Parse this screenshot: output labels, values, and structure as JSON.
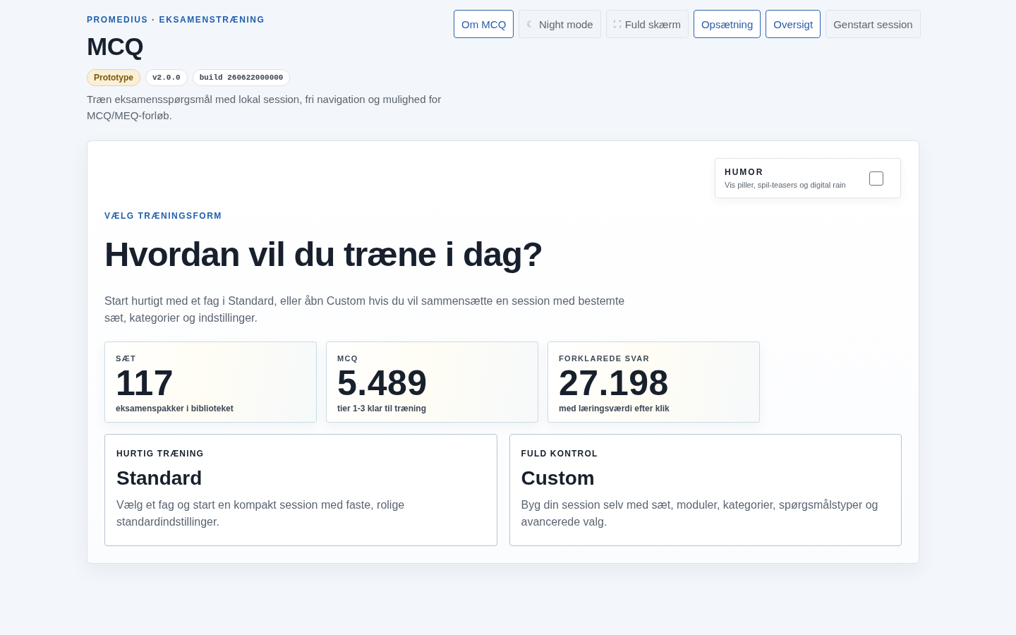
{
  "header": {
    "eyebrow": "PROMEDIUS · EKSAMENSTRÆNING",
    "title": "MCQ",
    "badges": [
      {
        "label": "Prototype",
        "kind": "status"
      },
      {
        "label": "v2.0.0",
        "kind": "code"
      },
      {
        "label": "build 260622000000",
        "kind": "code"
      }
    ],
    "description": "Træn eksamensspørgsmål med lokal session, fri navigation og mulighed for MCQ/MEQ-forløb."
  },
  "toolbar": [
    {
      "label": "Om MCQ",
      "highlighted": true,
      "kind": "plain"
    },
    {
      "label": "Night mode",
      "highlighted": false,
      "kind": "glyph",
      "glyph": "☾"
    },
    {
      "label": "Fuld skærm",
      "highlighted": false,
      "kind": "fullscreen"
    },
    {
      "label": "Opsætning",
      "highlighted": true,
      "kind": "plain"
    },
    {
      "label": "Oversigt",
      "highlighted": true,
      "kind": "plain"
    },
    {
      "label": "Genstart session",
      "highlighted": false,
      "kind": "plain"
    }
  ],
  "humor": {
    "title": "HUMOR",
    "description": "Vis piller, spil-teasers og digital rain",
    "checked": false
  },
  "intro": {
    "eyebrow": "VÆLG TRÆNINGSFORM",
    "heading": "Hvordan vil du træne i dag?",
    "lead": "Start hurtigt med et fag i Standard, eller åbn Custom hvis du vil sammensætte en session med bestemte sæt, kategorier og indstillinger."
  },
  "stats": [
    {
      "label": "SÆT",
      "value": "117",
      "caption": "eksamenspakker i biblioteket"
    },
    {
      "label": "MCQ",
      "value": "5.489",
      "caption": "tier 1-3 klar til træning"
    },
    {
      "label": "FORKLAREDE SVAR",
      "value": "27.198",
      "caption": "med læringsværdi efter klik"
    }
  ],
  "modes": [
    {
      "eyebrow": "HURTIG TRÆNING",
      "title": "Standard",
      "description": "Vælg et fag og start en kompakt session med faste, rolige standardindstillinger."
    },
    {
      "eyebrow": "FULD KONTROL",
      "title": "Custom",
      "description": "Byg din session selv med sæt, moduler, kategorier, spørgsmålstyper og avancerede valg."
    }
  ]
}
